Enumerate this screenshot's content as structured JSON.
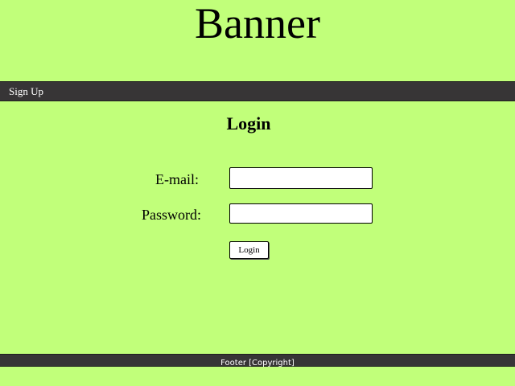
{
  "banner": {
    "title": "Banner"
  },
  "nav": {
    "items": [
      {
        "label": "Sign Up"
      }
    ]
  },
  "login_form": {
    "heading": "Login",
    "email_label": "E-mail:",
    "email_value": "",
    "password_label": "Password:",
    "password_value": "",
    "submit_label": "Login"
  },
  "footer": {
    "text": "Footer [Copyright]"
  },
  "colors": {
    "background": "#c1ff7a",
    "bar": "#373536",
    "bar_text": "#ffffff"
  }
}
